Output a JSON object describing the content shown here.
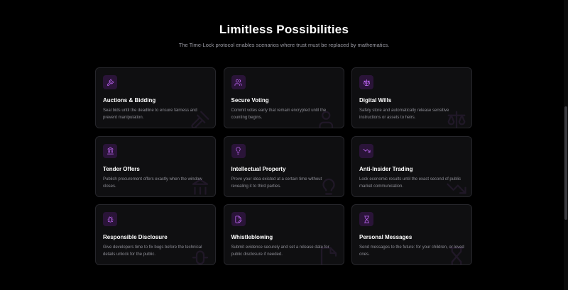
{
  "section": {
    "title": "Limitless Possibilities",
    "subtitle": "The Time-Lock protocol enables scenarios where trust must be replaced by mathematics."
  },
  "colors": {
    "background": "#000000",
    "card_background": "#0f0f11",
    "card_border": "#26262b",
    "accent": "#c76bff",
    "icon_background": "#2a1438"
  },
  "cards": [
    {
      "icon": "gavel-icon",
      "title": "Auctions & Bidding",
      "description": "Seal bids until the deadline to ensure fairness and prevent manipulation."
    },
    {
      "icon": "users-icon",
      "title": "Secure Voting",
      "description": "Commit votes early that remain encrypted until the counting begins."
    },
    {
      "icon": "scale-icon",
      "title": "Digital Wills",
      "description": "Safely store and automatically release sensitive instructions or assets to heirs."
    },
    {
      "icon": "landmark-icon",
      "title": "Tender Offers",
      "description": "Publish procurement offers exactly when the window closes."
    },
    {
      "icon": "lightbulb-icon",
      "title": "Intellectual Property",
      "description": "Prove your idea existed at a certain time without revealing it to third parties."
    },
    {
      "icon": "trending-down-icon",
      "title": "Anti-Insider Trading",
      "description": "Lock economic results until the exact second of public market communication."
    },
    {
      "icon": "bug-icon",
      "title": "Responsible Disclosure",
      "description": "Give developers time to fix bugs before the technical details unlock for the public."
    },
    {
      "icon": "file-pen-icon",
      "title": "Whistleblowing",
      "description": "Submit evidence securely and set a release date for public disclosure if needed."
    },
    {
      "icon": "hourglass-icon",
      "title": "Personal Messages",
      "description": "Send messages to the future: for your children, or loved ones."
    }
  ]
}
